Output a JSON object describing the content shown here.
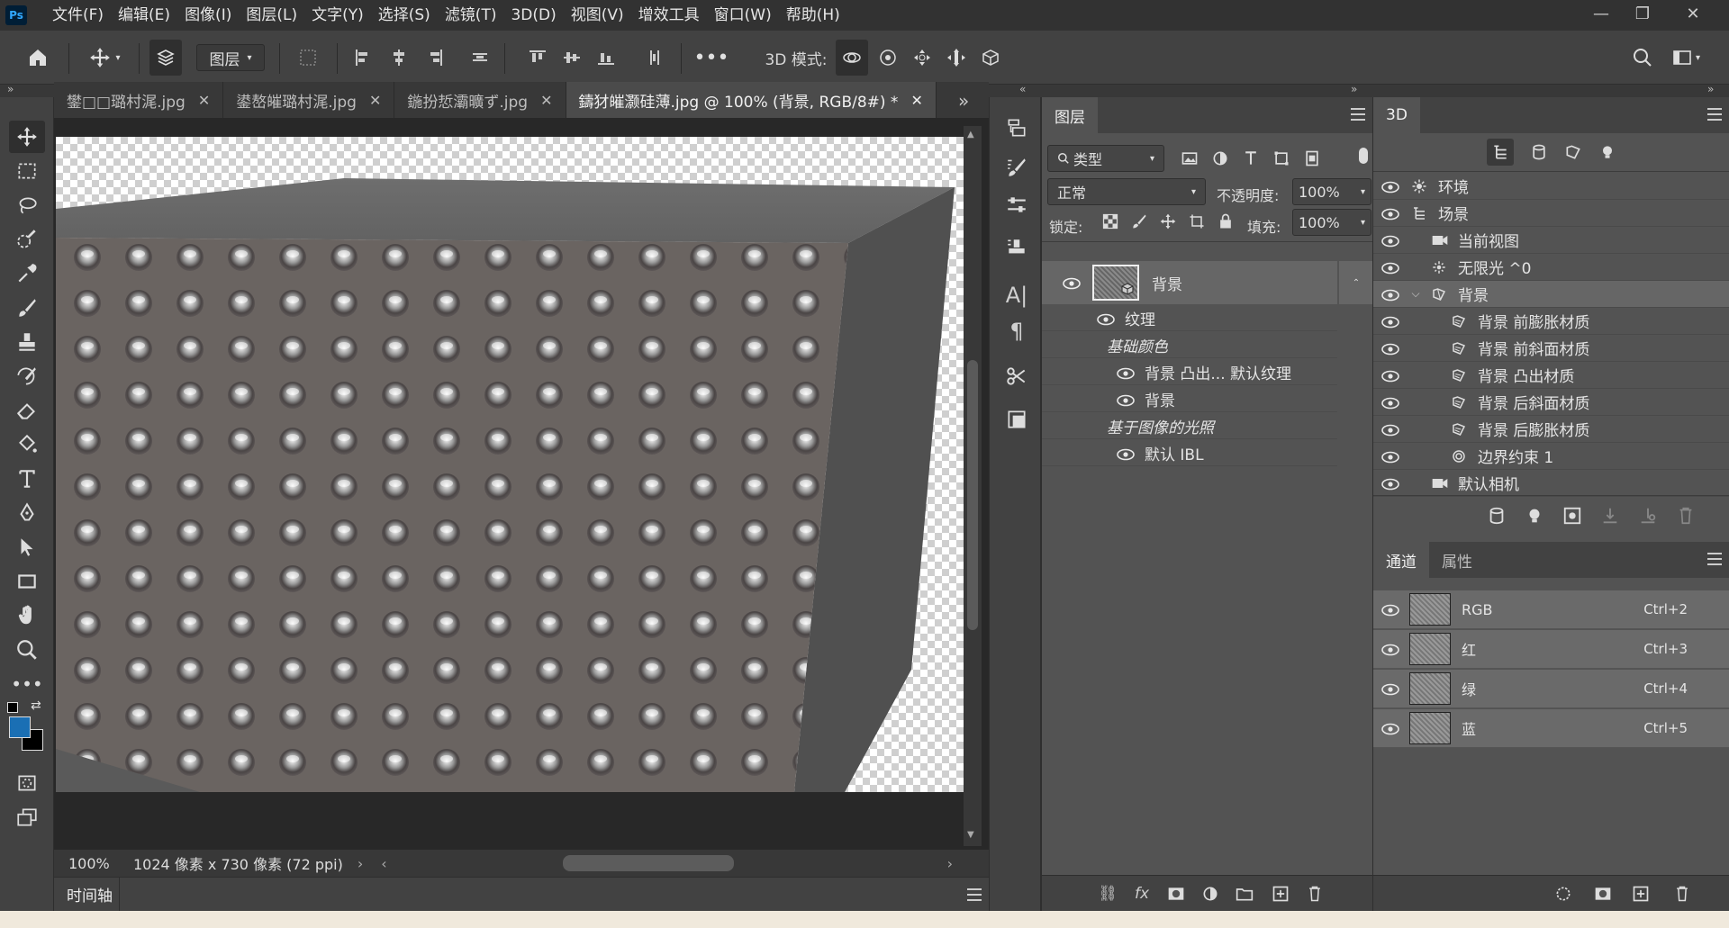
{
  "menubar": {
    "app_logo": "Ps",
    "items": [
      "文件(F)",
      "编辑(E)",
      "图像(I)",
      "图层(L)",
      "文字(Y)",
      "选择(S)",
      "滤镜(T)",
      "3D(D)",
      "视图(V)",
      "增效工具",
      "窗口(W)",
      "帮助(H)"
    ]
  },
  "options": {
    "layer_dropdown": "图层",
    "mode_label": "3D 模式:"
  },
  "tabs": [
    {
      "label": "鐢□□璐村浘.jpg",
      "active": false
    },
    {
      "label": "鍙嶅皠璐村浘.jpg",
      "active": false
    },
    {
      "label": "鍦扮悊灞曠ず.jpg",
      "active": false
    },
    {
      "label": "鑄犲皠灏硅薄.jpg @ 100% (背景, RGB/8#) *",
      "active": true
    }
  ],
  "status": {
    "zoom": "100%",
    "doc_info": "1024 像素 x 730 像素 (72 ppi)"
  },
  "timeline_label": "时间轴",
  "layers_panel": {
    "tab": "图层",
    "filter_kind": "类型",
    "blend_mode": "正常",
    "opacity_label": "不透明度:",
    "opacity_value": "100%",
    "lock_label": "锁定:",
    "fill_label": "填充:",
    "fill_value": "100%",
    "layer_name": "背景",
    "tree": [
      {
        "label": "纹理",
        "italic": false,
        "eye": true,
        "indent": 1
      },
      {
        "label": "基础颜色",
        "italic": true,
        "eye": false,
        "indent": 2
      },
      {
        "label": "背景 凸出... 默认纹理",
        "italic": false,
        "eye": true,
        "indent": 3
      },
      {
        "label": "背景",
        "italic": false,
        "eye": true,
        "indent": 3
      },
      {
        "label": "基于图像的光照",
        "italic": true,
        "eye": false,
        "indent": 2
      },
      {
        "label": "默认 IBL",
        "italic": false,
        "eye": true,
        "indent": 3
      }
    ]
  },
  "panel3d": {
    "tab": "3D",
    "rows": [
      {
        "label": "环境",
        "indent": 0,
        "icon": "env",
        "selected": false
      },
      {
        "label": "场景",
        "indent": 0,
        "icon": "scene",
        "selected": false
      },
      {
        "label": "当前视图",
        "indent": 1,
        "icon": "camera",
        "selected": false
      },
      {
        "label": "无限光 ^0",
        "indent": 1,
        "icon": "light",
        "selected": false
      },
      {
        "label": "背景",
        "indent": 1,
        "icon": "mesh",
        "selected": true
      },
      {
        "label": "背景 前膨胀材质",
        "indent": 2,
        "icon": "material",
        "selected": false
      },
      {
        "label": "背景 前斜面材质",
        "indent": 2,
        "icon": "material",
        "selected": false
      },
      {
        "label": "背景 凸出材质",
        "indent": 2,
        "icon": "material",
        "selected": false
      },
      {
        "label": "背景 后斜面材质",
        "indent": 2,
        "icon": "material",
        "selected": false
      },
      {
        "label": "背景 后膨胀材质",
        "indent": 2,
        "icon": "material",
        "selected": false
      },
      {
        "label": "边界约束 1",
        "indent": 2,
        "icon": "constraint",
        "selected": false
      },
      {
        "label": "默认相机",
        "indent": 1,
        "icon": "camera",
        "selected": false
      }
    ]
  },
  "channels_panel": {
    "tabs": [
      "通道",
      "属性"
    ],
    "rows": [
      {
        "name": "RGB",
        "shortcut": "Ctrl+2"
      },
      {
        "name": "红",
        "shortcut": "Ctrl+3"
      },
      {
        "name": "绿",
        "shortcut": "Ctrl+4"
      },
      {
        "name": "蓝",
        "shortcut": "Ctrl+5"
      }
    ]
  },
  "colors": {
    "foreground": "#1a6fb4",
    "background": "#000000"
  }
}
